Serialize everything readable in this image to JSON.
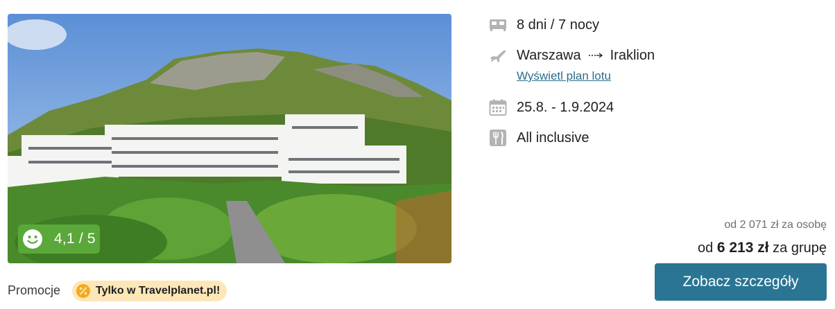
{
  "hotel_photo": {
    "alt": "Hotel photo"
  },
  "rating": {
    "score": "4,1 / 5",
    "icon": "smiley-face-icon",
    "color": "#5aa83a"
  },
  "promo": {
    "label": "Promocje",
    "badge_text": "Tylko w Travelplanet.pl!",
    "badge_icon": "percent-badge-icon",
    "badge_color": "#fde7b8"
  },
  "trip": {
    "duration": "8 dni / 7 nocy",
    "origin": "Warszawa",
    "destination": "Iraklion",
    "flight_plan_link": "Wyświetl plan lotu",
    "dates": "25.8. - 1.9.2024",
    "board": "All inclusive"
  },
  "price": {
    "per_person": "od 2 071 zł za osobę",
    "group_prefix": "od",
    "group_amount": "6 213 zł",
    "group_suffix": "za grupę"
  },
  "cta": {
    "label": "Zobacz szczegóły",
    "color": "#2a7593"
  }
}
